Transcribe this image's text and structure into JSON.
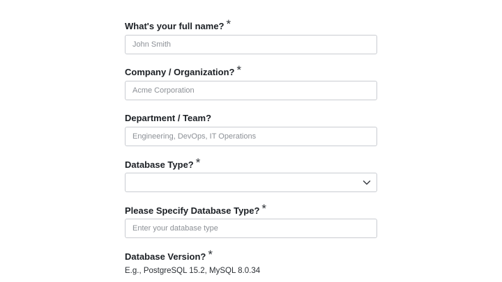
{
  "form": {
    "full_name": {
      "label": "What's your full name?",
      "required_mark": "*",
      "placeholder": "John Smith",
      "value": ""
    },
    "company": {
      "label": "Company / Organization?",
      "required_mark": "*",
      "placeholder": "Acme Corporation",
      "value": ""
    },
    "department": {
      "label": "Department / Team?",
      "placeholder": "Engineering, DevOps, IT Operations",
      "value": ""
    },
    "database_type": {
      "label": "Database Type?",
      "required_mark": "*",
      "selected": "",
      "icon": "chevron-down-icon"
    },
    "specify_database_type": {
      "label": "Please Specify Database Type?",
      "required_mark": "*",
      "placeholder": "Enter your database type",
      "value": ""
    },
    "database_version": {
      "label": "Database Version?",
      "required_mark": "*",
      "hint": "E.g., PostgreSQL 15.2, MySQL 8.0.34"
    }
  },
  "colors": {
    "border": "#c9ccd1",
    "placeholder": "#8c9096",
    "label": "#1b1f24"
  }
}
